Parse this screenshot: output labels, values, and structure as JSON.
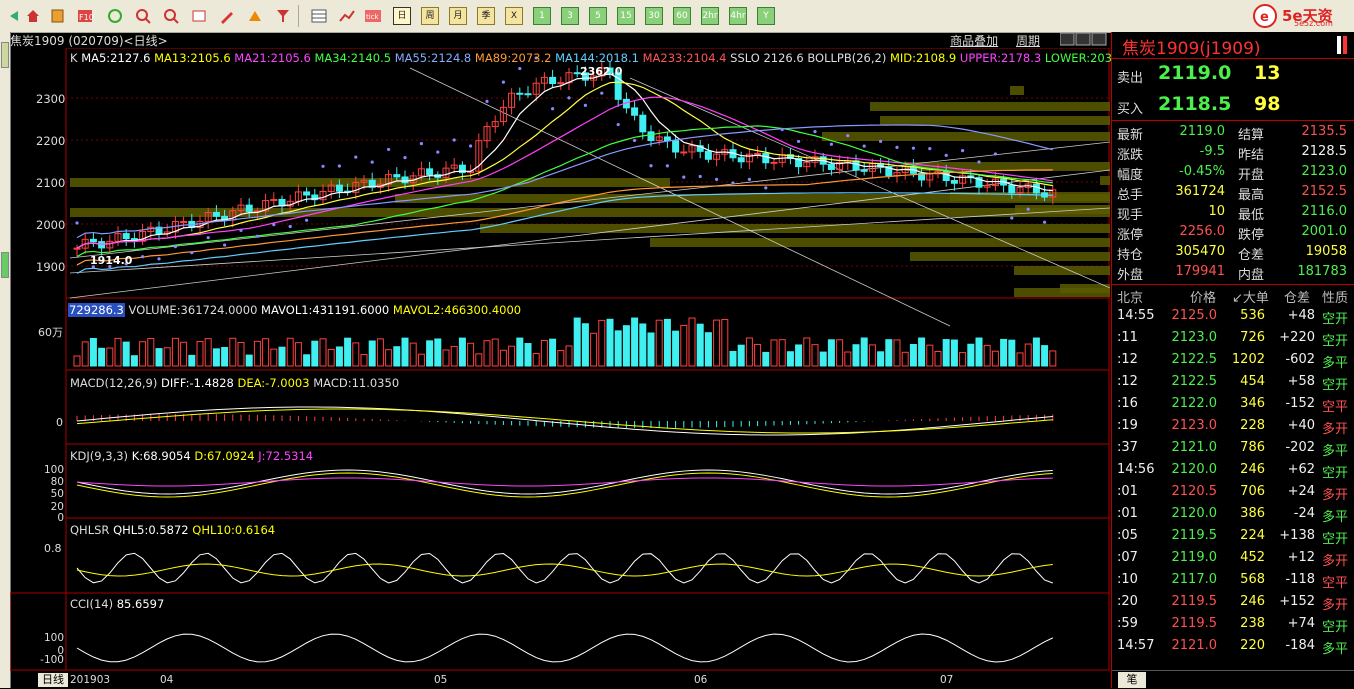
{
  "toolbar": {
    "period_buttons": [
      "日",
      "周",
      "月",
      "季",
      "X",
      "1",
      "3",
      "5",
      "15",
      "30",
      "60",
      "2hr",
      "4hr",
      "Y"
    ]
  },
  "logo": {
    "text": "5e天资",
    "sub": "5e5z.com"
  },
  "header": {
    "title": "焦炭1909 (020709)<日线>",
    "link_overlay": "商品叠加",
    "link_period": "周期"
  },
  "main": {
    "indicator_line": {
      "k": "K",
      "ma5": "MA5:2127.6",
      "ma13": "MA13:2105.6",
      "ma21": "MA21:2105.6",
      "ma34": "MA34:2140.5",
      "ma55": "MA55:2124.8",
      "ma89": "MA89:2073.2",
      "ma144": "MA144:2018.1",
      "ma233": "MA233:2104.4",
      "sslo": "SSLO 2126.6",
      "boll": "BOLLPB(26,2)",
      "mid": "MID:2108.9",
      "upper": "UPPER:2178.3",
      "lower": "LOWER:2039"
    },
    "y_ticks": [
      "2300",
      "2200",
      "2100",
      "2000",
      "1900"
    ],
    "high_label": "2362.0",
    "low_label": "1914.0"
  },
  "volume": {
    "hl": "729286.3",
    "text": "VOLUME:361724.0000",
    "mavol1": "MAVOL1:431191.6000",
    "mavol2": "MAVOL2:466300.4000",
    "tick": "60万"
  },
  "macd": {
    "text": "MACD(12,26,9)",
    "diff": "DIFF:-1.4828",
    "dea": "DEA:-7.0003",
    "macd": "MACD:11.0350",
    "tick": "0"
  },
  "kdj": {
    "text": "KDJ(9,3,3)",
    "k": "K:68.9054",
    "d": "D:67.0924",
    "j": "J:72.5314",
    "ticks": [
      "100",
      "80",
      "50",
      "20",
      "0"
    ]
  },
  "qhlsr": {
    "text": "QHLSR",
    "q5": "QHL5:0.5872",
    "q10": "QHL10:0.6164",
    "tick": "0.8"
  },
  "cci": {
    "text": "CCI(14)",
    "val": "85.6597",
    "ticks": [
      "100",
      "0",
      "-100"
    ]
  },
  "xaxis": {
    "labels": [
      "201903",
      "04",
      "05",
      "06",
      "07"
    ],
    "tab": "日线"
  },
  "right_panel": {
    "title": "焦炭1909(j1909)",
    "sell_label": "卖出",
    "sell_price": "2119.0",
    "sell_vol": "13",
    "buy_label": "买入",
    "buy_price": "2118.5",
    "buy_vol": "98",
    "stats": [
      {
        "l1": "最新",
        "v1": "2119.0",
        "c1": "green",
        "l2": "结算",
        "v2": "2135.5",
        "c2": "red"
      },
      {
        "l1": "涨跌",
        "v1": "-9.5",
        "c1": "green",
        "l2": "昨结",
        "v2": "2128.5",
        "c2": "white"
      },
      {
        "l1": "幅度",
        "v1": "-0.45%",
        "c1": "green",
        "l2": "开盘",
        "v2": "2123.0",
        "c2": "green"
      },
      {
        "l1": "总手",
        "v1": "361724",
        "c1": "yellow",
        "l2": "最高",
        "v2": "2152.5",
        "c2": "red"
      },
      {
        "l1": "现手",
        "v1": "10",
        "c1": "yellow",
        "l2": "最低",
        "v2": "2116.0",
        "c2": "green"
      },
      {
        "l1": "涨停",
        "v1": "2256.0",
        "c1": "red",
        "l2": "跌停",
        "v2": "2001.0",
        "c2": "green"
      },
      {
        "l1": "持仓",
        "v1": "305470",
        "c1": "yellow",
        "l2": "仓差",
        "v2": "19058",
        "c2": "yellow"
      },
      {
        "l1": "外盘",
        "v1": "179941",
        "c1": "red",
        "l2": "内盘",
        "v2": "181783",
        "c2": "green"
      }
    ],
    "trade_header": {
      "city": "北京",
      "price": "价格",
      "vol": "↙大单",
      "oi": "仓差",
      "nature": "性质"
    },
    "trades": [
      {
        "t": "14:55",
        "p": "2125.0",
        "pc": "red",
        "v": "536",
        "o": "+48",
        "n": "空开",
        "nc": "green"
      },
      {
        "t": ":11",
        "p": "2123.0",
        "pc": "green",
        "v": "726",
        "o": "+220",
        "n": "空开",
        "nc": "green"
      },
      {
        "t": ":12",
        "p": "2122.5",
        "pc": "green",
        "v": "1202",
        "o": "-602",
        "n": "多平",
        "nc": "green"
      },
      {
        "t": ":12",
        "p": "2122.5",
        "pc": "green",
        "v": "454",
        "o": "+58",
        "n": "空开",
        "nc": "green"
      },
      {
        "t": ":16",
        "p": "2122.0",
        "pc": "green",
        "v": "346",
        "o": "-152",
        "n": "空平",
        "nc": "red"
      },
      {
        "t": ":19",
        "p": "2123.0",
        "pc": "red",
        "v": "228",
        "o": "+40",
        "n": "多开",
        "nc": "red"
      },
      {
        "t": ":37",
        "p": "2121.0",
        "pc": "green",
        "v": "786",
        "o": "-202",
        "n": "多平",
        "nc": "green"
      },
      {
        "t": "14:56",
        "p": "2120.0",
        "pc": "green",
        "v": "246",
        "o": "+62",
        "n": "空开",
        "nc": "green"
      },
      {
        "t": ":01",
        "p": "2120.5",
        "pc": "red",
        "v": "706",
        "o": "+24",
        "n": "多开",
        "nc": "red"
      },
      {
        "t": ":01",
        "p": "2120.0",
        "pc": "green",
        "v": "386",
        "o": "-24",
        "n": "多平",
        "nc": "green"
      },
      {
        "t": ":05",
        "p": "2119.5",
        "pc": "green",
        "v": "224",
        "o": "+138",
        "n": "空开",
        "nc": "green"
      },
      {
        "t": ":07",
        "p": "2119.0",
        "pc": "green",
        "v": "452",
        "o": "+12",
        "n": "多开",
        "nc": "red"
      },
      {
        "t": ":10",
        "p": "2117.0",
        "pc": "green",
        "v": "568",
        "o": "-118",
        "n": "空平",
        "nc": "red"
      },
      {
        "t": ":20",
        "p": "2119.5",
        "pc": "red",
        "v": "246",
        "o": "+152",
        "n": "多开",
        "nc": "red"
      },
      {
        "t": ":59",
        "p": "2119.5",
        "pc": "red",
        "v": "238",
        "o": "+74",
        "n": "空开",
        "nc": "green"
      },
      {
        "t": "14:57",
        "p": "2121.0",
        "pc": "red",
        "v": "220",
        "o": "-184",
        "n": "多平",
        "nc": "green"
      }
    ],
    "bottom_tab": "笔"
  }
}
